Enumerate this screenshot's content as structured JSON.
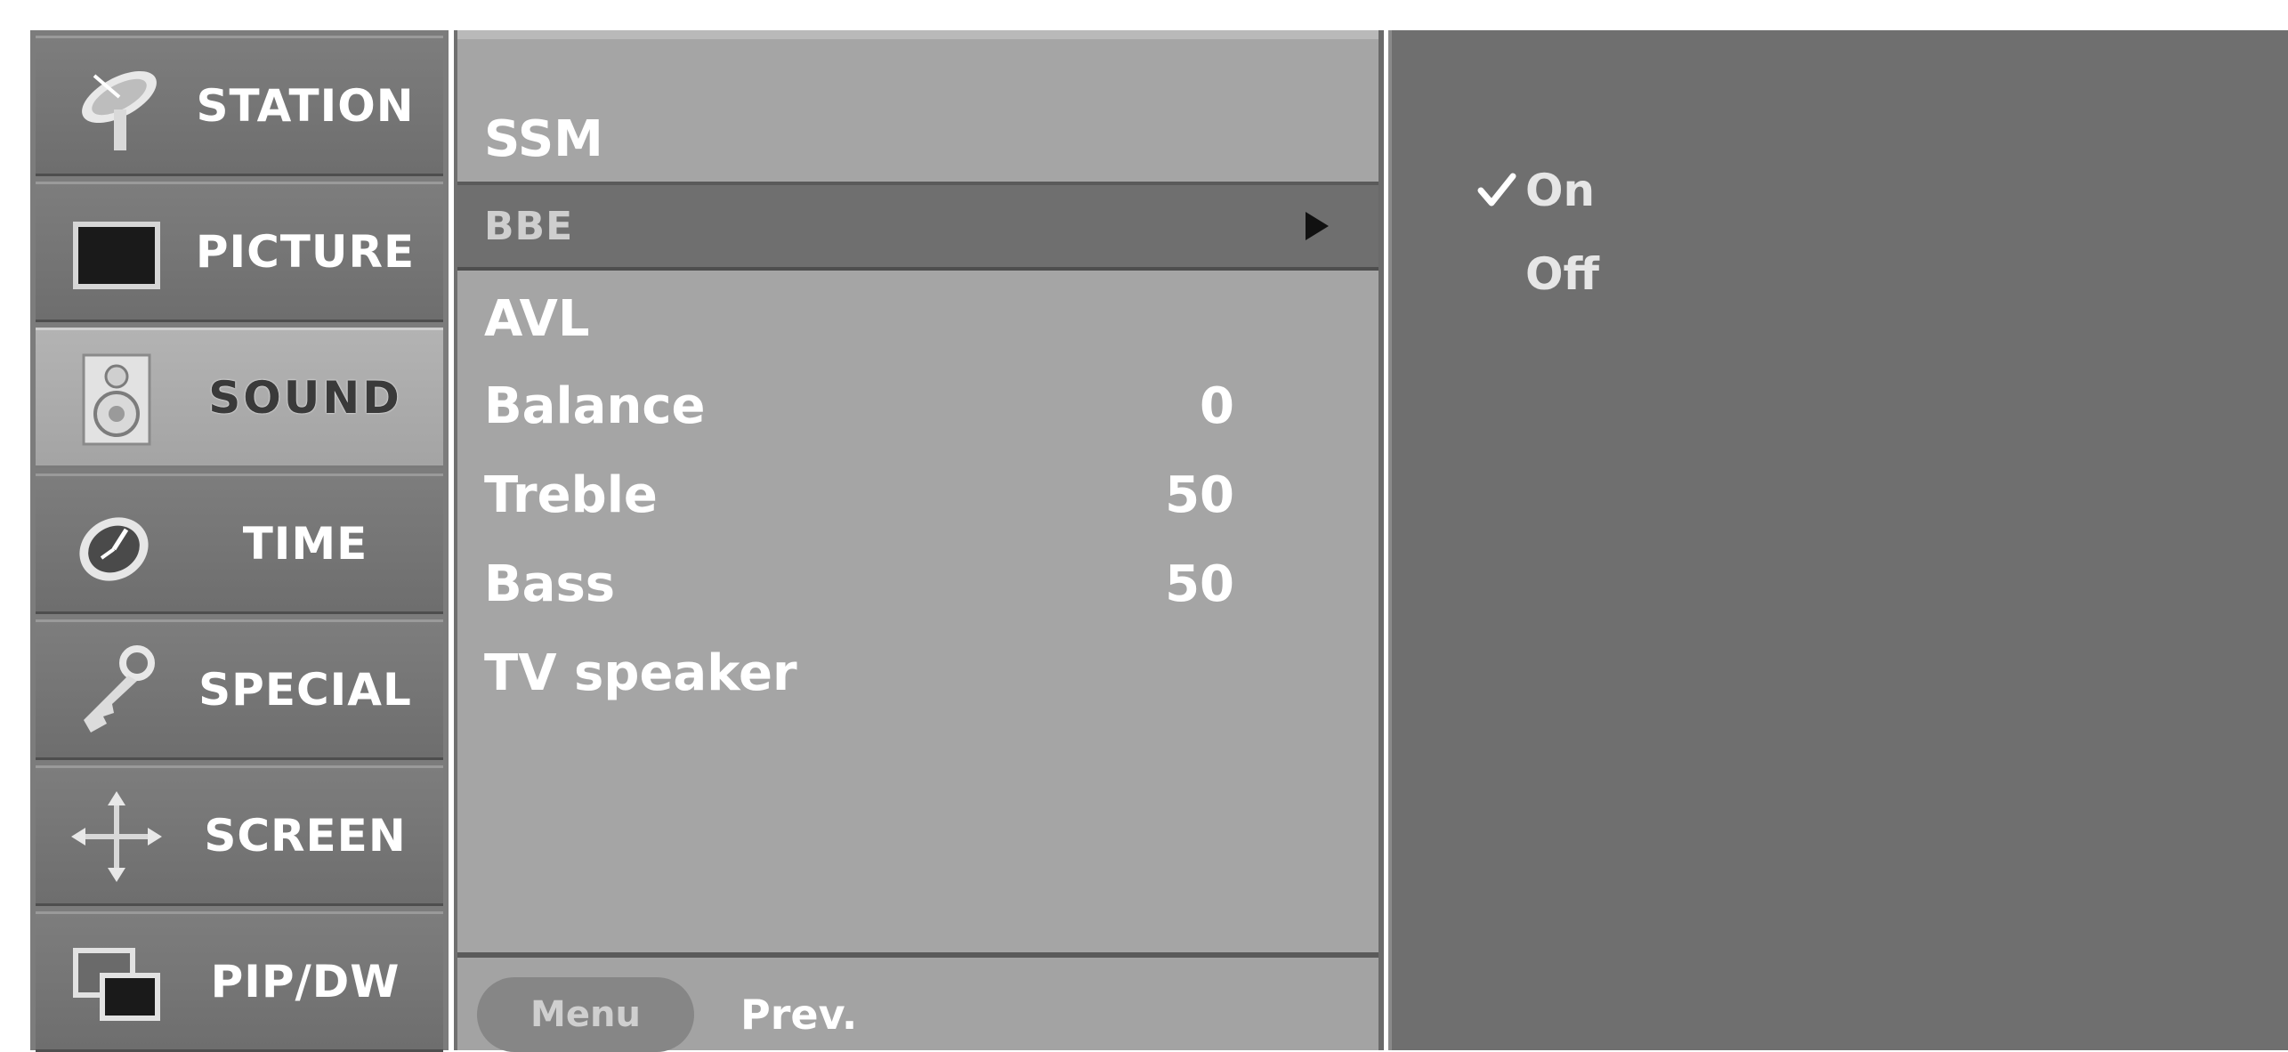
{
  "sidebar": {
    "items": [
      {
        "label": "STATION",
        "icon": "satellite-dish-icon"
      },
      {
        "label": "PICTURE",
        "icon": "tv-screen-icon"
      },
      {
        "label": "SOUND",
        "icon": "speaker-icon",
        "active": true
      },
      {
        "label": "TIME",
        "icon": "clock-icon"
      },
      {
        "label": "SPECIAL",
        "icon": "key-icon"
      },
      {
        "label": "SCREEN",
        "icon": "move-arrows-icon"
      },
      {
        "label": "PIP/DW",
        "icon": "pip-icon"
      }
    ]
  },
  "sound_menu": {
    "items": [
      {
        "label": "SSM",
        "value": ""
      },
      {
        "label": "BBE",
        "value": "",
        "selected": true
      },
      {
        "label": "AVL",
        "value": ""
      },
      {
        "label": "Balance",
        "value": "0"
      },
      {
        "label": "Treble",
        "value": "50"
      },
      {
        "label": "Bass",
        "value": "50"
      },
      {
        "label": "TV speaker",
        "value": ""
      }
    ],
    "footer": {
      "menu_button": "Menu",
      "prev_label": "Prev."
    }
  },
  "options": {
    "items": [
      {
        "label": "On",
        "checked": true
      },
      {
        "label": "Off",
        "checked": false
      }
    ]
  },
  "colors": {
    "active_item_bg": "#a9a9a9",
    "inactive_item_bg": "#757575",
    "menu_bg": "#a5a5a5",
    "panel_bg": "#6f6f6f",
    "text": "#ffffff"
  }
}
